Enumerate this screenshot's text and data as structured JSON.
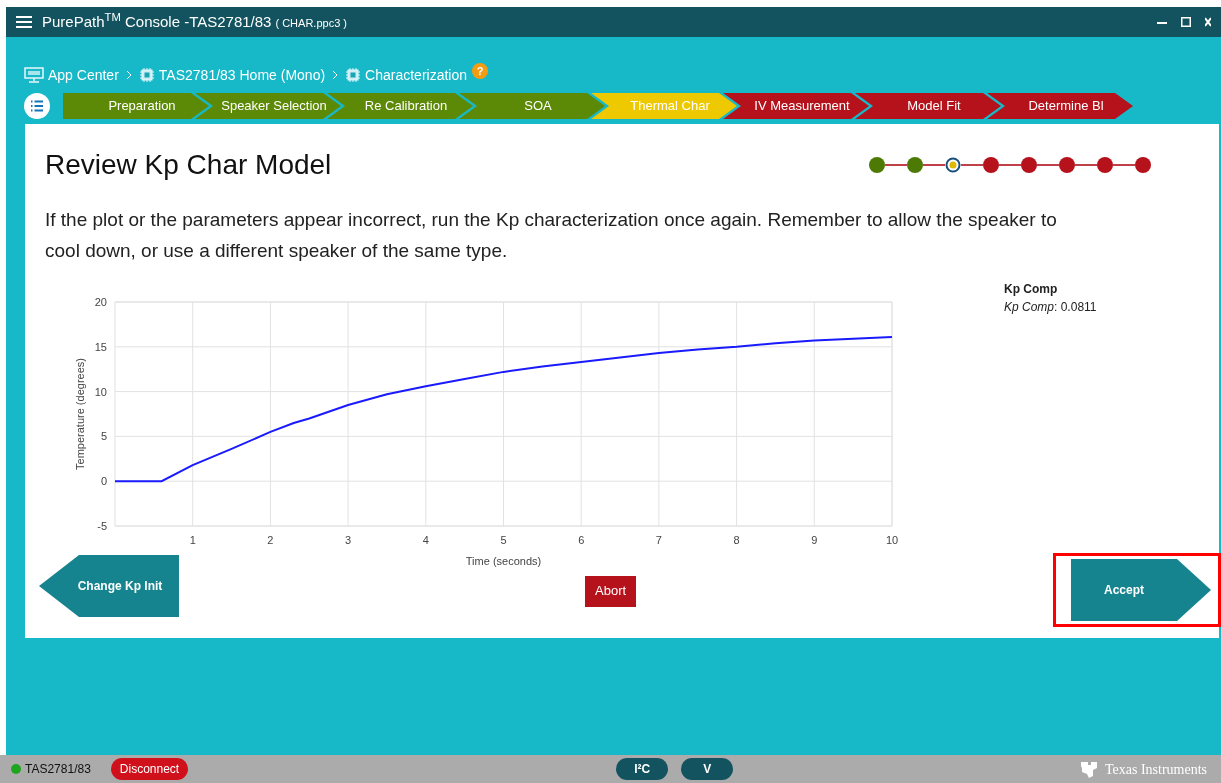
{
  "window": {
    "title": "PurePath$^{TM}$ Console -TAS2781/83",
    "file": "( CHAR.ppc3 )"
  },
  "breadcrumbs": [
    {
      "label": "App Center",
      "kind": "monitor"
    },
    {
      "label": "TAS2781/83 Home (Mono)",
      "kind": "chip"
    },
    {
      "label": "Characterization",
      "kind": "chip"
    }
  ],
  "help": "?",
  "steps": [
    {
      "label": "Preparation",
      "kind": "done"
    },
    {
      "label": "Speaker Selection",
      "kind": "done"
    },
    {
      "label": "Re Calibration",
      "kind": "done"
    },
    {
      "label": "SOA",
      "kind": "done"
    },
    {
      "label": "Thermal Char",
      "kind": "current"
    },
    {
      "label": "IV Measurement",
      "kind": "pending"
    },
    {
      "label": "Model Fit",
      "kind": "pending"
    },
    {
      "label": "Determine Bl",
      "kind": "pending"
    }
  ],
  "page": {
    "title": "Review Kp Char Model",
    "progress": [
      {
        "kind": "done"
      },
      {
        "kind": "done"
      },
      {
        "kind": "current"
      },
      {
        "kind": "pending"
      },
      {
        "kind": "pending"
      },
      {
        "kind": "pending"
      },
      {
        "kind": "pending"
      },
      {
        "kind": "pending"
      }
    ],
    "text": "If the plot or the parameters appear incorrect, run the Kp characterization once again. Remember to allow the speaker to cool down, or use a different speaker of the same type."
  },
  "chart_data": {
    "type": "line",
    "xlabel": "Time (seconds)",
    "ylabel": "Temperature (degrees)",
    "x": [
      0,
      0.5,
      0.6,
      1,
      1.5,
      2,
      2.3,
      2.5,
      3,
      3.5,
      4,
      4.5,
      5,
      5.5,
      6,
      6.5,
      7,
      7.5,
      8,
      8.5,
      9,
      9.5,
      10
    ],
    "series": [
      {
        "color": "#1a1aff",
        "values": [
          0,
          0,
          0,
          1.8,
          3.6,
          5.5,
          6.5,
          7,
          8.5,
          9.7,
          10.6,
          11.4,
          12.2,
          12.8,
          13.3,
          13.8,
          14.3,
          14.7,
          15,
          15.4,
          15.7,
          15.9,
          16.1
        ]
      }
    ],
    "xlim": [
      0,
      10
    ],
    "ylim": [
      -5,
      20
    ],
    "grid": true,
    "xticks": [
      1,
      2,
      3,
      4,
      5,
      6,
      7,
      8,
      9,
      10
    ],
    "yticks": [
      -5,
      0,
      5,
      10,
      15,
      20
    ]
  },
  "parameter": {
    "title": "Kp Comp",
    "name": "Kp Comp",
    "value": ": 0.0811"
  },
  "buttons": {
    "back": "Change Kp Init",
    "abort": "Abort",
    "accept": "Accept",
    "accept_highlighted": true
  },
  "status_bar": {
    "device": "TAS2781/83",
    "connected": true,
    "disconnect": "Disconnect",
    "i2c": "I²C",
    "v": "V",
    "brand": "Texas Instruments"
  }
}
